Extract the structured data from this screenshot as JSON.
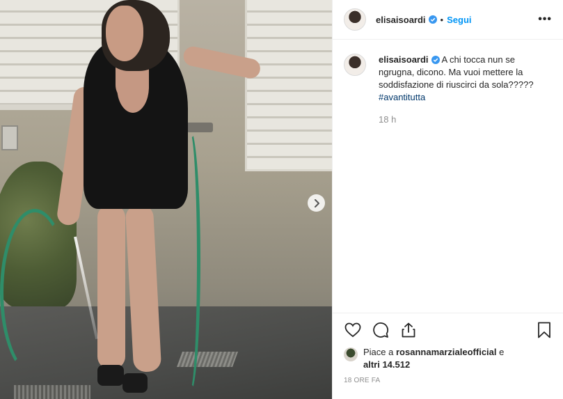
{
  "post": {
    "username": "elisaisoardi",
    "follow_label": "Segui",
    "separator": "•",
    "more_label": "•••",
    "caption": {
      "text": "A chi tocca nun se ngrugna, dicono. Ma vuoi mettere la soddisfazione di riuscirci da sola?????",
      "hashtag": "#avantitutta",
      "time": "18 h"
    },
    "likes": {
      "prefix": "Piace a",
      "user": "rosannamarzialeofficial",
      "conjunction": "e",
      "others": "altri 14.512"
    },
    "timestamp": "18 ORE FA",
    "icons": {
      "like": "heart-icon",
      "comment": "comment-icon",
      "share": "share-icon",
      "save": "bookmark-icon",
      "next": "chevron-right-icon",
      "verified": "verified-badge-icon"
    },
    "colors": {
      "accent": "#0095f6",
      "verified": "#3897f0",
      "hashtag": "#00376b",
      "muted": "#8e8e8e"
    }
  }
}
